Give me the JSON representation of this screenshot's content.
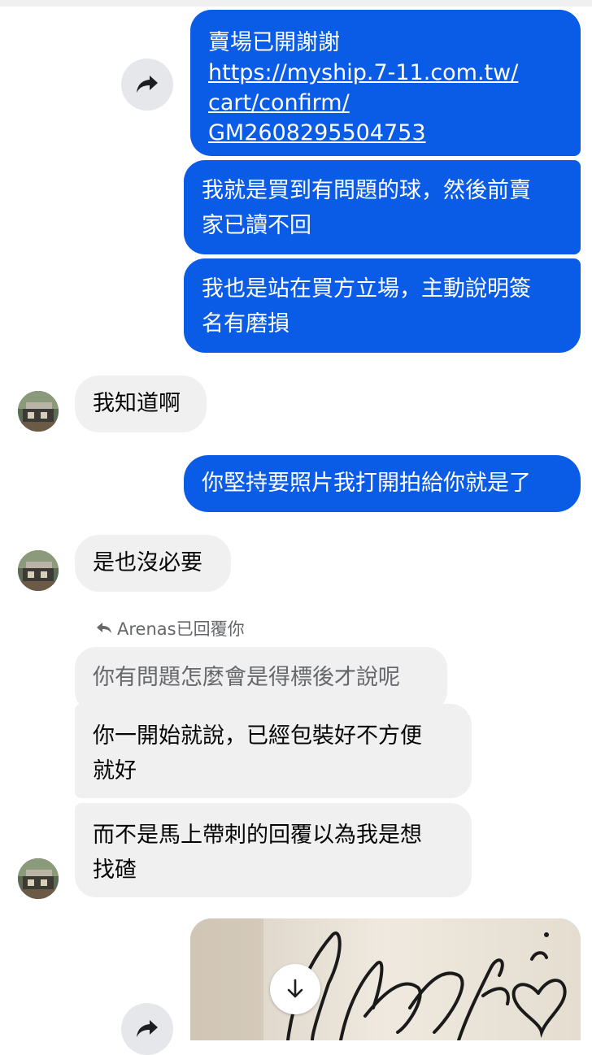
{
  "messages": {
    "m1_line1": "賣場已開謝謝",
    "m1_link_1": "https://myship.7-11.com.tw/",
    "m1_link_2": "cart/confirm/",
    "m1_link_3": "GM2608295504753",
    "m2_line1": "我就是買到有問題的球，然後前賣",
    "m2_line2": "家已讀不回",
    "m3_line1": "我也是站在買方立場，主動說明簽",
    "m3_line2": "名有磨損",
    "m4": "我知道啊",
    "m5": "你堅持要照片我打開拍給你就是了",
    "m6": "是也沒必要",
    "reply_note": "Arenas已回覆你",
    "m7_quoted": "你有問題怎麼會是得標後才說呢",
    "m8_line1": "你一開始就說，已經包裝好不方便",
    "m8_line2": "就好",
    "m9_line1": "而不是馬上帶刺的回覆以為我是想",
    "m9_line2": "找碴"
  },
  "colors": {
    "outgoing_bubble": "#0a5ce6",
    "incoming_bubble": "#f0f0f0"
  },
  "icons": [
    "forward-icon",
    "reply-arrow-icon",
    "download-icon",
    "avatar"
  ]
}
